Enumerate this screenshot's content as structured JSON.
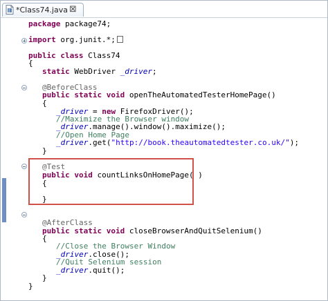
{
  "tab": {
    "title": "*Class74.java",
    "close": "⊠"
  },
  "lines": [
    "package package74;",
    "import org.junit.*;",
    "public class Class74",
    "{",
    "static WebDriver _driver;",
    "@BeforeClass",
    "public static void openTheAutomatedTesterHomePage()",
    "{",
    "_driver = new FirefoxDriver();",
    "//Maximize the Browser window",
    "_driver.manage().window().maximize();",
    "//Open Home Page",
    "_driver.get(\"http://book.theautomatedtester.co.uk/\");",
    "}",
    "@Test",
    "public void countLinksOnHomePage( )",
    "{",
    "}",
    "@AfterClass",
    "public static void closeBrowserAndQuitSelenium()",
    "{",
    "//Close the Browser Window",
    "_driver.close();",
    "//Quit Selenium session",
    "_driver.quit();",
    "}",
    "}"
  ],
  "tokens": {
    "package": "package",
    "package_name": " package74;",
    "import": "import",
    "import_name": " org.junit.*;",
    "public": "public",
    "class": "class",
    "class_name": " Class74",
    "static": "static",
    "void": "void",
    "new": "new",
    "webdriver": "WebDriver ",
    "driver": "_driver",
    "semicolon": ";",
    "before_class": "@BeforeClass",
    "test": "@Test",
    "after_class": "@AfterClass",
    "open_method": " openTheAutomatedTesterHomePage()",
    "count_method": " countLinksOnHomePage( )",
    "close_method": " closeBrowserAndQuitSelenium()",
    "assign": " = ",
    "firefox": " FirefoxDriver();",
    "maximize_comment": "//Maximize the Browser window",
    "maximize_call": ".manage().window().maximize();",
    "open_comment": "//Open Home Page",
    "get_call_start": ".get(",
    "url": "\"http://book.theautomatedtester.co.uk/\"",
    "get_call_end": ");",
    "close_comment": "//Close the Browser Window",
    "close_call": ".close();",
    "quit_comment": "//Quit Selenium session",
    "quit_call": ".quit();",
    "open_brace": "{",
    "close_brace": "}"
  },
  "colors": {
    "keyword": "#7f0055",
    "annotation": "#646464",
    "comment": "#3f7f5f",
    "string": "#2a00ff",
    "field": "#0000c0",
    "highlight_border": "#cf4f49",
    "change_bar": "#6d8fc4"
  }
}
